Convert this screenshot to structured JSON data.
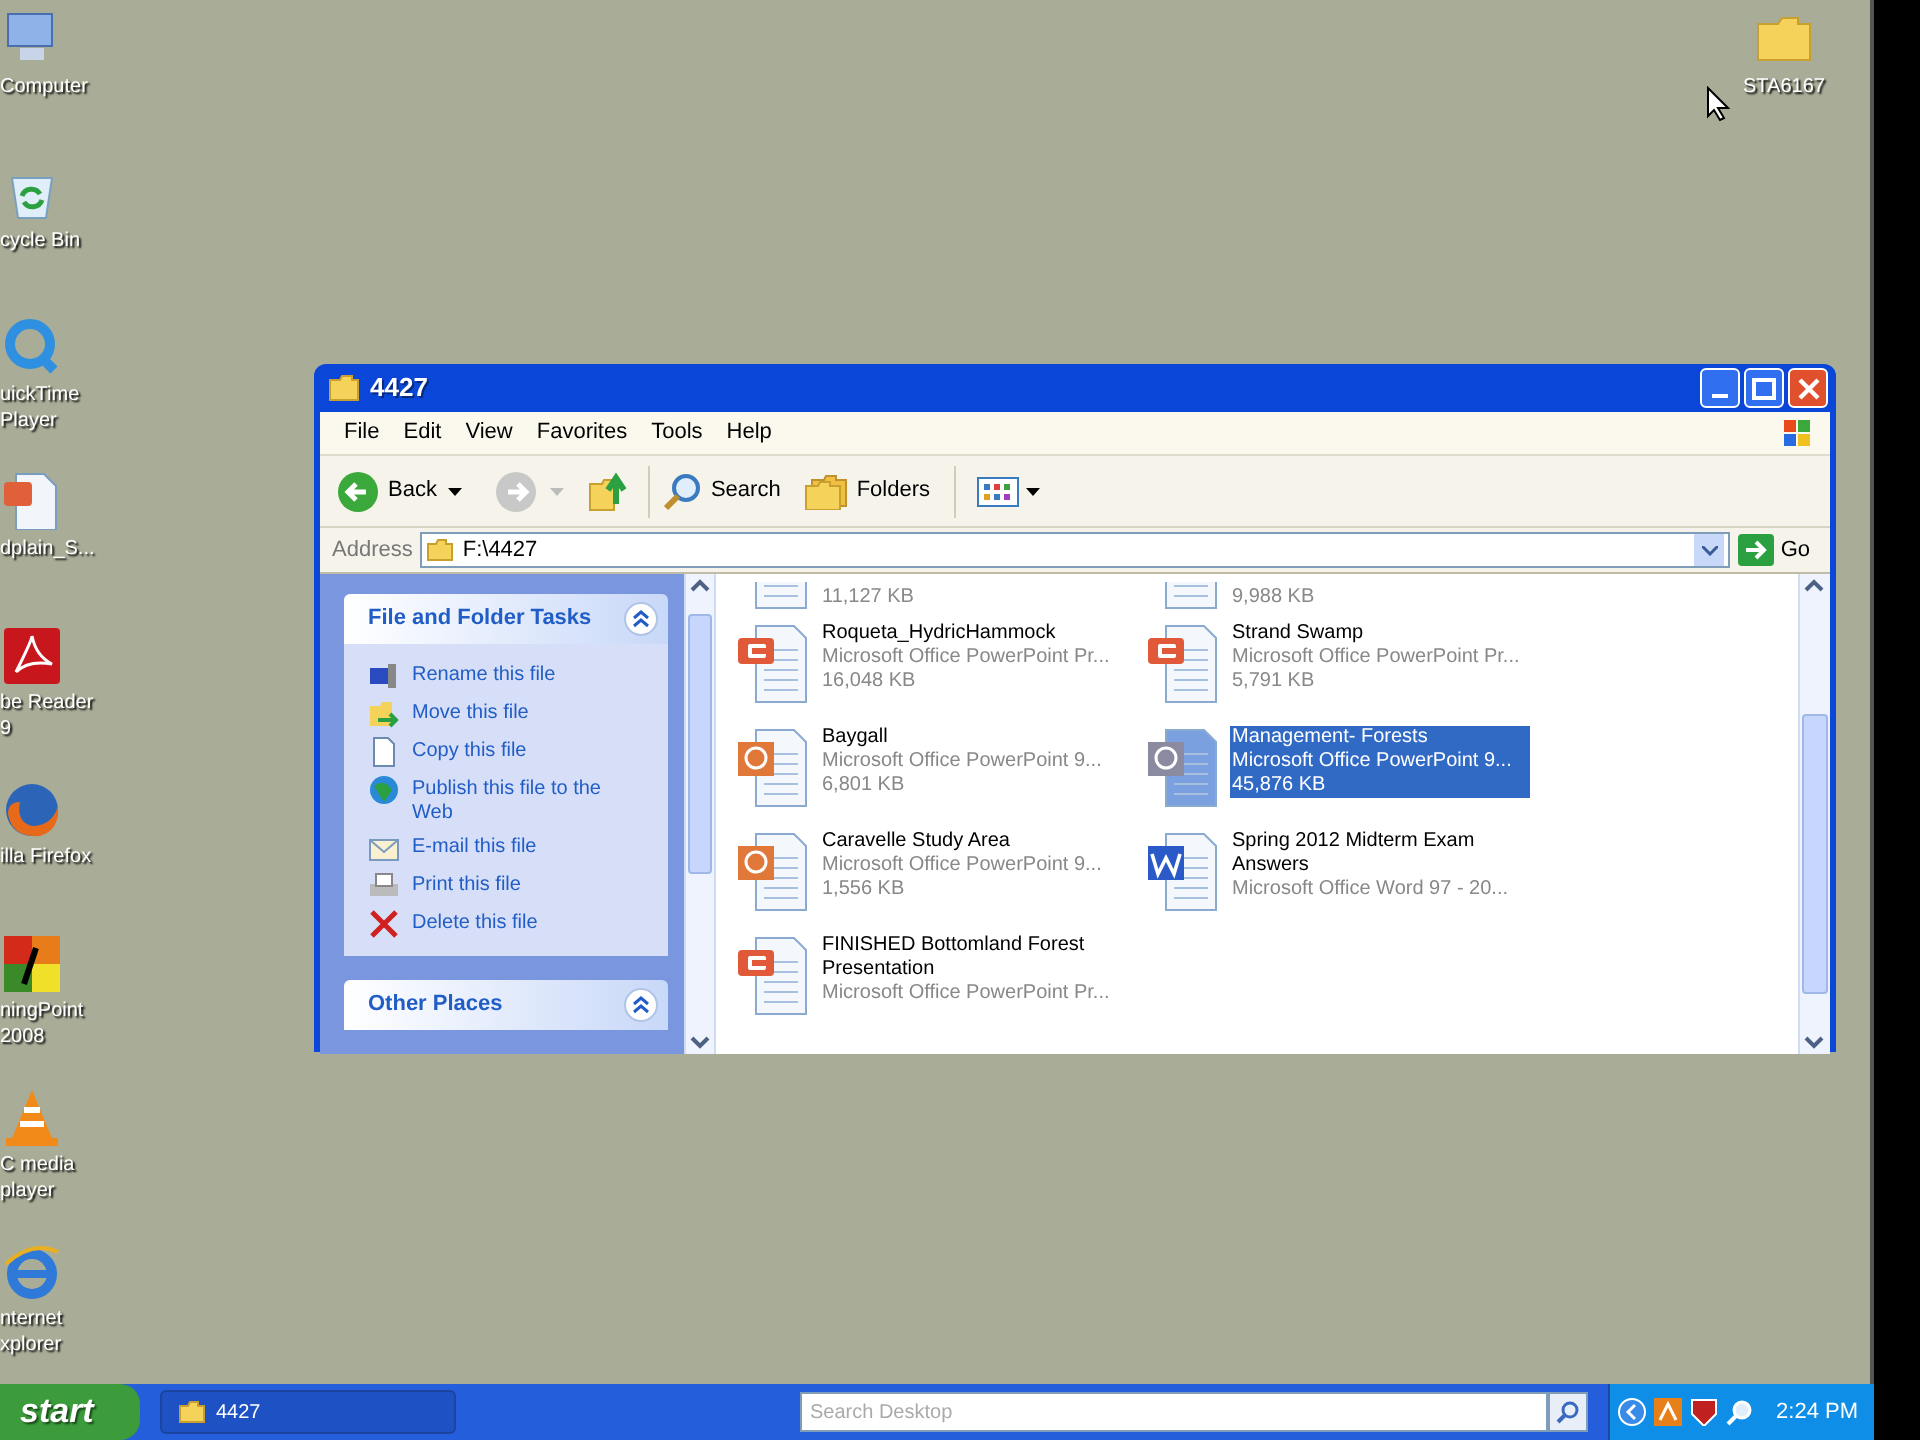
{
  "desktop_icons": [
    {
      "label": "Computer",
      "kind": "computer"
    },
    {
      "label": "cycle Bin",
      "kind": "recycle"
    },
    {
      "label": "uickTime\nPlayer",
      "kind": "quicktime"
    },
    {
      "label": "dplain_S...",
      "kind": "ppt"
    },
    {
      "label": "be Reader\n9",
      "kind": "pdf"
    },
    {
      "label": "illa Firefox",
      "kind": "firefox"
    },
    {
      "label": "ningPoint\n2008",
      "kind": "turning"
    },
    {
      "label": "C media\nplayer",
      "kind": "vlc"
    },
    {
      "label": "nternet\nxplorer",
      "kind": "ie"
    }
  ],
  "desktop_icons_right": [
    {
      "label": "STA6167",
      "kind": "folder"
    }
  ],
  "window": {
    "title": "4427",
    "menu": [
      "File",
      "Edit",
      "View",
      "Favorites",
      "Tools",
      "Help"
    ],
    "toolbar": {
      "back": "Back",
      "search": "Search",
      "folders": "Folders"
    },
    "address": {
      "label": "Address",
      "value": "F:\\4427",
      "go": "Go"
    },
    "tasks_panel": {
      "title": "File and Folder Tasks",
      "items": [
        {
          "label": "Rename this file",
          "kind": "rename"
        },
        {
          "label": "Move this file",
          "kind": "move"
        },
        {
          "label": "Copy this file",
          "kind": "copy"
        },
        {
          "label": "Publish this file to the Web",
          "kind": "publish"
        },
        {
          "label": "E-mail this file",
          "kind": "email"
        },
        {
          "label": "Print this file",
          "kind": "print"
        },
        {
          "label": "Delete this file",
          "kind": "delete"
        }
      ]
    },
    "other_places": {
      "title": "Other Places"
    },
    "files": [
      {
        "size": "11,127 KB",
        "kind": "partial",
        "selected": false
      },
      {
        "size": "9,988 KB",
        "kind": "partial",
        "selected": false
      },
      {
        "name": "Roqueta_HydricHammock",
        "type": "Microsoft Office PowerPoint Pr...",
        "size": "16,048 KB",
        "kind": "pptx",
        "selected": false
      },
      {
        "name": "Strand Swamp",
        "type": "Microsoft Office PowerPoint Pr...",
        "size": "5,791 KB",
        "kind": "pptx",
        "selected": false
      },
      {
        "name": "Baygall",
        "type": "Microsoft Office PowerPoint 9...",
        "size": "6,801 KB",
        "kind": "ppt",
        "selected": false
      },
      {
        "name": "Management- Forests",
        "type": "Microsoft Office PowerPoint 9...",
        "size": "45,876 KB",
        "kind": "ppt",
        "selected": true
      },
      {
        "name": "Caravelle Study Area",
        "type": "Microsoft Office PowerPoint 9...",
        "size": "1,556 KB",
        "kind": "ppt",
        "selected": false
      },
      {
        "name": "Spring 2012 Midterm Exam Answers",
        "type": "Microsoft Office Word 97 - 20...",
        "kind": "word",
        "selected": false
      },
      {
        "name": "FINISHED Bottomland Forest Presentation",
        "type": "Microsoft Office PowerPoint Pr...",
        "kind": "pptx",
        "selected": false
      }
    ]
  },
  "taskbar": {
    "start": "start",
    "task": "4427",
    "search_placeholder": "Search Desktop",
    "time": "2:24 PM"
  }
}
